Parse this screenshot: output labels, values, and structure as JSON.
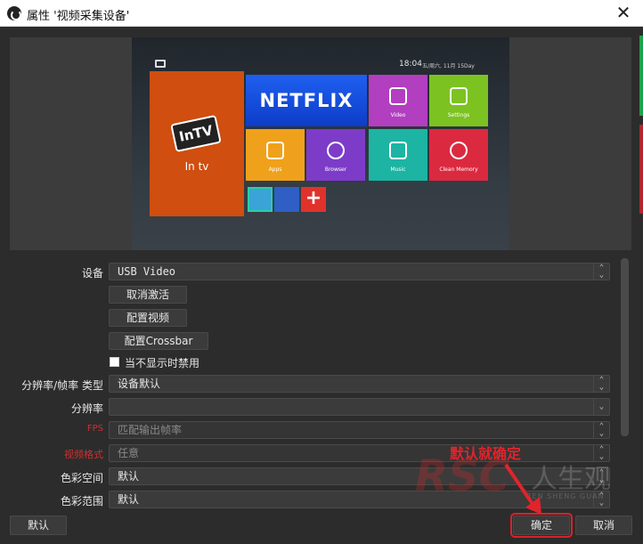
{
  "window": {
    "title": "属性 '视频采集设备'",
    "close": "✕"
  },
  "preview": {
    "clock": "18:04",
    "clock_sub": "五/周六, 11月 15Day",
    "tiles": {
      "intv_logo": "InTV",
      "intv_label": "In tv",
      "netflix": "NETFLIX",
      "video": "Video",
      "settings": "Settings",
      "apps": "Apps",
      "browser": "Browser",
      "music": "Music",
      "clean": "Clean Memory"
    }
  },
  "form": {
    "device_label": "设备",
    "device_value": "USB Video",
    "deactivate_button": "取消激活",
    "config_video_button": "配置视频",
    "config_crossbar_button": "配置Crossbar",
    "hide_disable_label": "当不显示时禁用",
    "hide_disable_checked": false,
    "res_type_label": "分辨率/帧率 类型",
    "res_type_value": "设备默认",
    "resolution_label": "分辨率",
    "resolution_value": "",
    "fps_label": "FPS",
    "fps_value": "匹配输出帧率",
    "video_format_label": "视频格式",
    "video_format_value": "任意",
    "color_space_label": "色彩空间",
    "color_space_value": "默认",
    "color_range_label": "色彩范围",
    "color_range_value": "默认"
  },
  "buttons": {
    "default": "默认",
    "ok": "确定",
    "cancel": "取消"
  },
  "annotation": {
    "text": "默认就确定",
    "color": "#e0242b"
  },
  "watermark": {
    "logo": "RSC",
    "cn": "人生观",
    "en": "REN SHENG GUAN"
  }
}
